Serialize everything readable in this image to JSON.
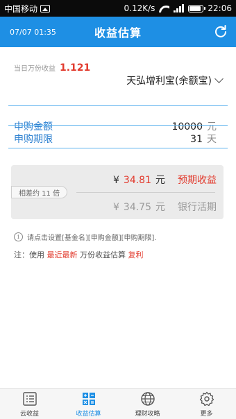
{
  "status_bar": {
    "carrier": "中国移动",
    "speed": "0.12K/s",
    "time": "22:06"
  },
  "header": {
    "date": "07/07 01:35",
    "title": "收益估算"
  },
  "fund": {
    "wanfen_label": "当日万份收益",
    "wanfen_value": "1.121",
    "selected_fund": "天弘增利宝(余额宝)"
  },
  "form": {
    "amount_label": "申购金额",
    "amount_value": "10000",
    "amount_unit": "元",
    "period_label": "申购期限",
    "period_value": "31",
    "period_unit": "天"
  },
  "result": {
    "currency_symbol": "¥",
    "expected_amount": "34.81",
    "expected_unit": "元",
    "expected_label": "预期收益",
    "bank_amount": "34.75",
    "bank_unit": "元",
    "bank_label": "银行活期",
    "diff_badge": "相差约 11 倍"
  },
  "hint": "请点击设置[基金名][申购金额][申购期限].",
  "note": {
    "prefix": "注：使用",
    "highlight1": "最近最新",
    "middle": "万份收益估算",
    "highlight2": "复利"
  },
  "tabs": [
    {
      "label": "云收益",
      "icon": "list-icon"
    },
    {
      "label": "收益估算",
      "icon": "calculator-icon"
    },
    {
      "label": "理财攻略",
      "icon": "globe-icon"
    },
    {
      "label": "更多",
      "icon": "gear-icon"
    }
  ],
  "colors": {
    "accent": "#1e8fe4",
    "highlight_red": "#e23b2e"
  }
}
